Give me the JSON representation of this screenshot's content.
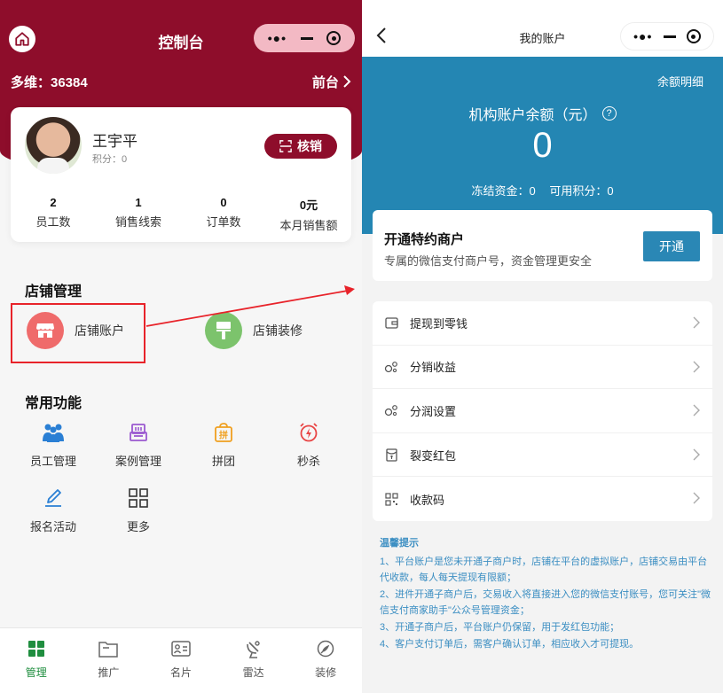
{
  "left": {
    "title": "控制台",
    "duowei": "多维：36384",
    "front_link": "前台",
    "user": {
      "name": "王宇平",
      "points": "积分：0",
      "verify_btn": "核销"
    },
    "stats": [
      {
        "value": "2",
        "label": "员工数"
      },
      {
        "value": "1",
        "label": "销售线索"
      },
      {
        "value": "0",
        "label": "订单数"
      },
      {
        "value": "0元",
        "label": "本月销售额"
      }
    ],
    "store_section": "店铺管理",
    "store_items": [
      {
        "label": "店铺账户",
        "icon": "store-icon",
        "color": "#ef6b6b"
      },
      {
        "label": "店铺装修",
        "icon": "brush-icon",
        "color": "#7cc36c"
      }
    ],
    "func_section": "常用功能",
    "functions": [
      {
        "label": "员工管理",
        "icon": "staff-icon"
      },
      {
        "label": "案例管理",
        "icon": "case-icon"
      },
      {
        "label": "拼团",
        "icon": "group-buy-icon"
      },
      {
        "label": "秒杀",
        "icon": "flash-sale-icon"
      },
      {
        "label": "报名活动",
        "icon": "signup-icon"
      },
      {
        "label": "更多",
        "icon": "more-grid-icon"
      }
    ],
    "tabs": [
      {
        "label": "管理",
        "icon": "manage-icon",
        "active": true
      },
      {
        "label": "推广",
        "icon": "promote-icon"
      },
      {
        "label": "名片",
        "icon": "card-icon"
      },
      {
        "label": "雷达",
        "icon": "radar-icon"
      },
      {
        "label": "装修",
        "icon": "decorate-icon"
      }
    ]
  },
  "right": {
    "title": "我的账户",
    "detail_link": "余额明细",
    "balance_title": "机构账户余额（元）",
    "balance": "0",
    "frozen": "冻结资金：0",
    "points": "可用积分：0",
    "merchant": {
      "title": "开通特约商户",
      "desc": "专属的微信支付商户号，资金管理更安全",
      "button": "开通"
    },
    "menu": [
      {
        "label": "提现到零钱",
        "icon": "wallet-icon"
      },
      {
        "label": "分销收益",
        "icon": "share-income-icon"
      },
      {
        "label": "分润设置",
        "icon": "profit-settings-icon"
      },
      {
        "label": "裂变红包",
        "icon": "red-packet-icon"
      },
      {
        "label": "收款码",
        "icon": "qr-code-icon"
      }
    ],
    "tips_title": "温馨提示",
    "tips": [
      "1、平台账户是您未开通子商户时，店铺在平台的虚拟账户，店铺交易由平台代收款，每人每天提现有限额；",
      "2、进件开通子商户后，交易收入将直接进入您的微信支付账号，您可关注\"微信支付商家助手\"公众号管理资金；",
      "3、开通子商户后，平台账户仍保留，用于发红包功能；",
      "4、客户支付订单后，需客户确认订单，相应收入才可提现。"
    ]
  },
  "colors": {
    "brand_red": "#8e0d2b",
    "account_blue": "#2486b3",
    "active_green": "#1f8e3f",
    "annotation_red": "#e8232a"
  }
}
